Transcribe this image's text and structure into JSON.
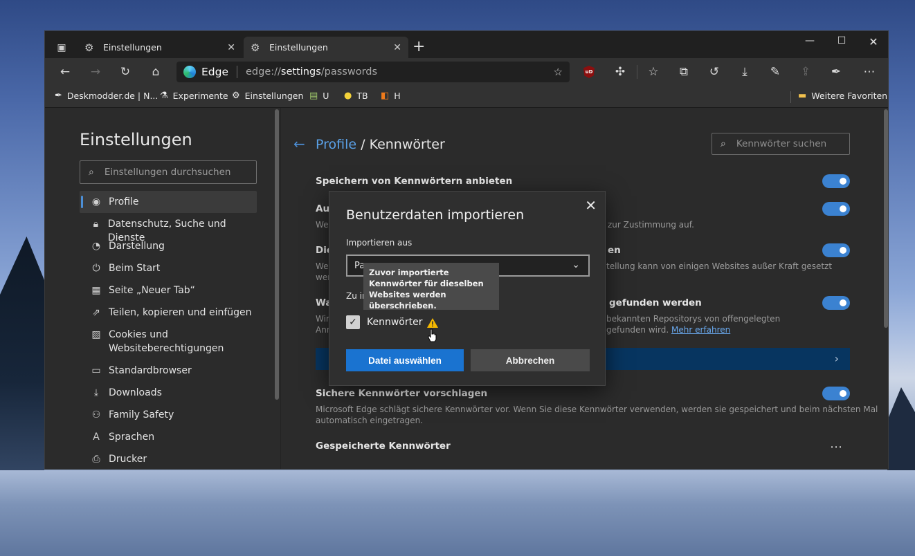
{
  "tabs": [
    {
      "title": "Einstellungen",
      "icon": "gear-icon",
      "active": false
    },
    {
      "title": "Einstellungen",
      "icon": "gear-icon",
      "active": true
    }
  ],
  "toolbar": {
    "site_label": "Edge",
    "url_scheme": "edge://",
    "url_host": "settings",
    "url_path": "/passwords",
    "ublock_label": "uD"
  },
  "favorites": [
    {
      "label": "Deskmodder.de | N...",
      "icon": "pen-icon"
    },
    {
      "label": "Experimente",
      "icon": "flask-icon"
    },
    {
      "label": "Einstellungen",
      "icon": "gear-icon"
    },
    {
      "label": "U",
      "icon": "extension-icon"
    },
    {
      "label": "TB",
      "icon": "coin-icon"
    },
    {
      "label": "H",
      "icon": "stack-icon"
    }
  ],
  "favorites_more": "Weitere Favoriten",
  "sidebar": {
    "title": "Einstellungen",
    "search_placeholder": "Einstellungen durchsuchen",
    "items": [
      {
        "label": "Profile",
        "icon": "profile-icon",
        "selected": true
      },
      {
        "label": "Datenschutz, Suche und Dienste",
        "icon": "lock-icon"
      },
      {
        "label": "Darstellung",
        "icon": "palette-icon"
      },
      {
        "label": "Beim Start",
        "icon": "power-icon"
      },
      {
        "label": "Seite „Neuer Tab“",
        "icon": "newtab-icon"
      },
      {
        "label": "Teilen, kopieren und einfügen",
        "icon": "share-icon"
      },
      {
        "label": "Cookies und",
        "label2": "Websiteberechtigungen",
        "icon": "cookie-icon"
      },
      {
        "label": "Standardbrowser",
        "icon": "browser-icon"
      },
      {
        "label": "Downloads",
        "icon": "download-icon"
      },
      {
        "label": "Family Safety",
        "icon": "family-icon"
      },
      {
        "label": "Sprachen",
        "icon": "language-icon"
      },
      {
        "label": "Drucker",
        "icon": "printer-icon"
      }
    ]
  },
  "main": {
    "breadcrumb": "Profile",
    "breadcrumb_sep": " / ",
    "page_title": "Kennwörter",
    "search_placeholder": "Kennwörter suchen",
    "settings": [
      {
        "title": "Speichern von Kennwörtern anbieten",
        "desc": ""
      },
      {
        "title": "Aut",
        "desc": "Wer",
        "desc_right": "zur Zustimmung auf."
      },
      {
        "title": "Die",
        "title_right": "en",
        "desc": "Wer",
        "desc2": "wer",
        "desc_right": "tellung kann von einigen Websites außer Kraft gesetzt"
      },
      {
        "title": "Wa",
        "title_right": "gefunden werden",
        "desc": "Wir",
        "desc2": "Ann",
        "desc_right": "bekannten Repositorys von offengelegten",
        "desc_right2": "gefunden wird.",
        "link": "Mehr erfahren"
      },
      {
        "title": "Sichere Kennwörter vorschlagen",
        "desc": "Microsoft Edge schlägt sichere Kennwörter vor. Wenn Sie diese Kennwörter verwenden, werden sie gespeichert und beim nächsten Mal",
        "desc2": "automatisch eingetragen."
      },
      {
        "title": "Gespeicherte Kennwörter"
      }
    ]
  },
  "dialog": {
    "title": "Benutzerdaten importieren",
    "import_from_label": "Importieren aus",
    "import_from_value": "Pa",
    "import_sub_label": "Zu im",
    "checkbox_label": "Kennwörter",
    "tooltip": "Zuvor importierte Kennwörter für dieselben Websites werden überschrieben.",
    "primary_button": "Datei auswählen",
    "secondary_button": "Abbrechen"
  },
  "colors": {
    "accent": "#3b82d1",
    "primary_button": "#1a73d0",
    "warning": "#f5b800"
  }
}
